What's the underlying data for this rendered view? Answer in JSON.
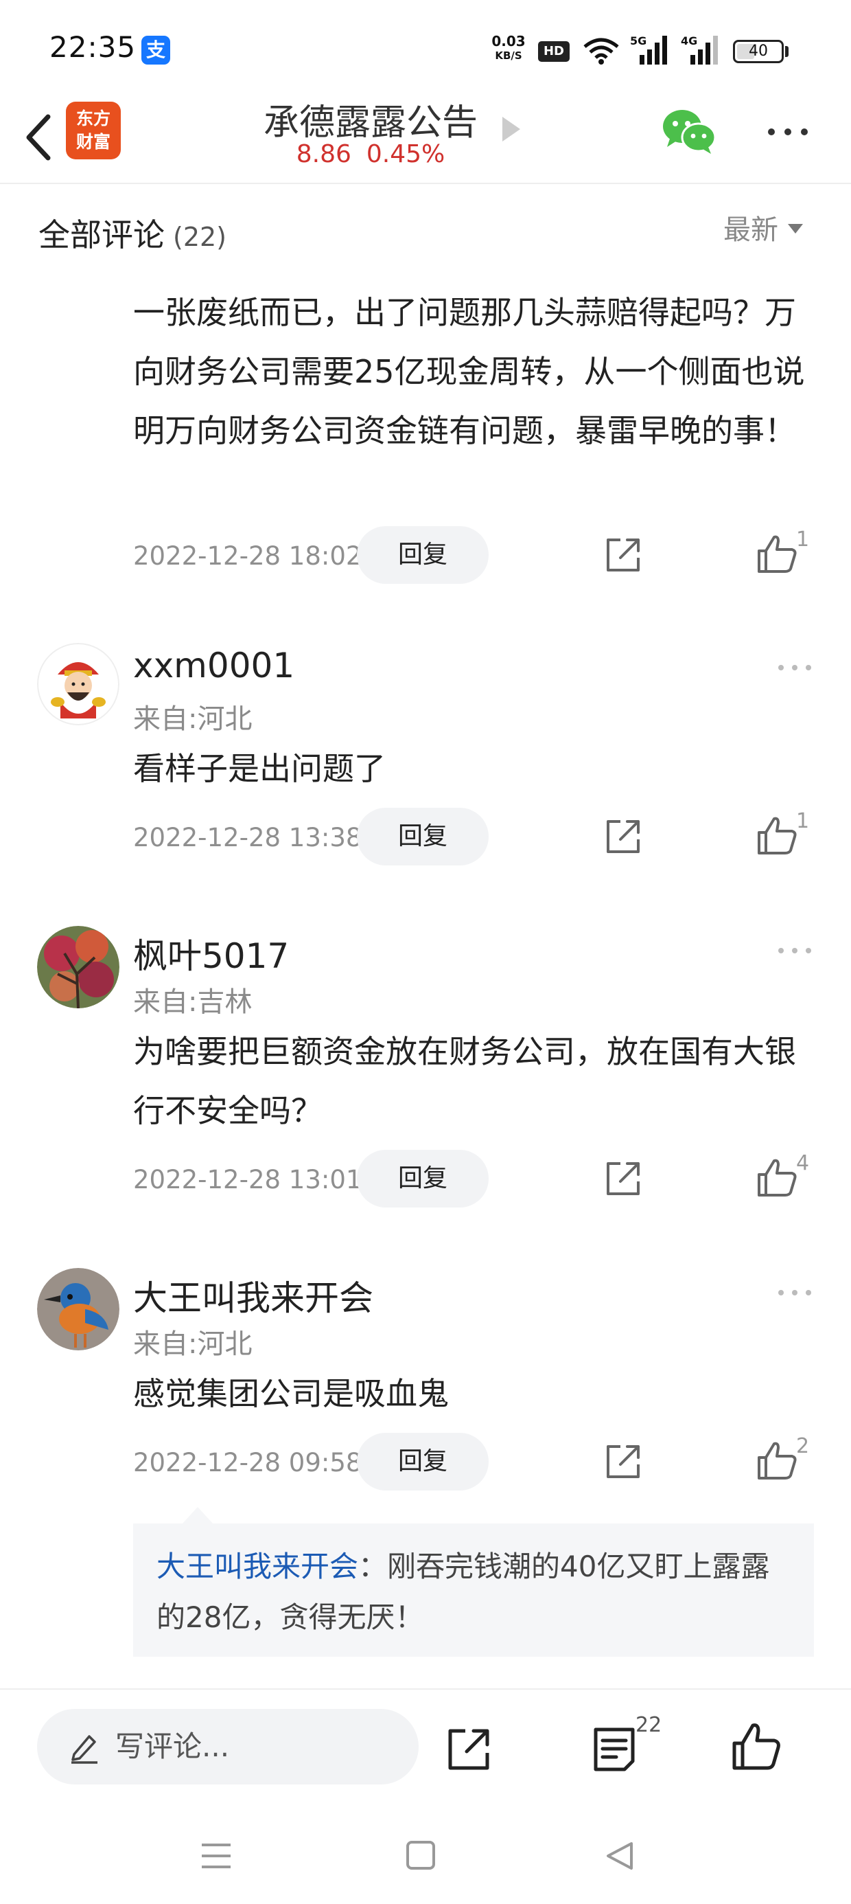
{
  "status_bar": {
    "time": "22:35",
    "app_badge": "支",
    "net_speed_value": "0.03",
    "net_speed_unit": "KB/S",
    "hd_label": "HD",
    "signal_5g": "5G",
    "signal_4g": "4G",
    "battery": "40",
    "battery_level": 0.4
  },
  "header": {
    "logo_line1": "东方",
    "logo_line2": "财富",
    "title": "承德露露公告",
    "price": "8.86",
    "change": "0.45%"
  },
  "comments_section": {
    "title": "全部评论",
    "count": "(22)",
    "sort_label": "最新"
  },
  "comments": [
    {
      "text": "一张废纸而已，出了问题那几头蒜赔得起吗？万向财务公司需要25亿现金周转，从一个侧面也说明万向财务公司资金链有问题，暴雷早晚的事！",
      "time": "2022-12-28 18:02",
      "reply_label": "回复",
      "likes": "1"
    },
    {
      "name": "xxm0001",
      "location": "来自:河北",
      "text": "看样子是出问题了",
      "time": "2022-12-28 13:38",
      "reply_label": "回复",
      "likes": "1"
    },
    {
      "name": "枫叶5017",
      "location": "来自:吉林",
      "text": "为啥要把巨额资金放在财务公司，放在国有大银行不安全吗？",
      "time": "2022-12-28 13:01",
      "reply_label": "回复",
      "likes": "4"
    },
    {
      "name": "大王叫我来开会",
      "location": "来自:河北",
      "text": "感觉集团公司是吸血鬼",
      "time": "2022-12-28 09:58",
      "reply_label": "回复",
      "likes": "2",
      "sub_reply": {
        "author": "大王叫我来开会",
        "text": "：刚吞完钱潮的40亿又盯上露露的28亿，贪得无厌！"
      }
    }
  ],
  "bottom_bar": {
    "write_placeholder": "写评论...",
    "comment_count": "22"
  },
  "colors": {
    "accent_red": "#d0312d",
    "link_blue": "#1c5bb4",
    "logo_orange": "#e8501e",
    "wechat_green": "#4cbf4b"
  }
}
